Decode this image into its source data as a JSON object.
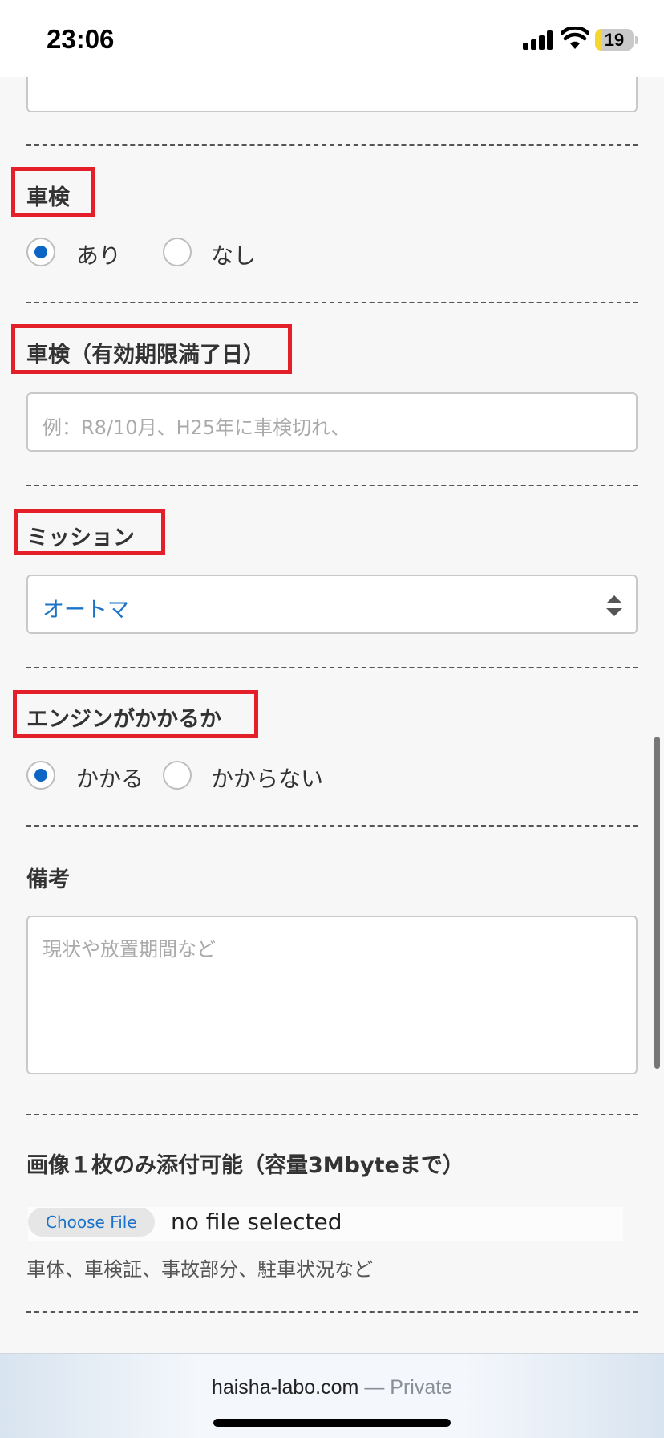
{
  "status_bar": {
    "time": "23:06",
    "battery_level": "19",
    "battery_fill": 0.19
  },
  "form": {
    "shaken": {
      "label": "車検",
      "options": [
        "あり",
        "なし"
      ],
      "selected": "あり"
    },
    "shaken_expiry": {
      "label": "車検（有効期限満了日）",
      "placeholder": "例：R8/10月、H25年に車検切れ、"
    },
    "mission": {
      "label": "ミッション",
      "value": "オートマ"
    },
    "engine": {
      "label": "エンジンがかかるか",
      "options": [
        "かかる",
        "かからない"
      ],
      "selected": "かかる"
    },
    "remarks": {
      "label": "備考",
      "placeholder": "現状や放置期間など"
    },
    "image": {
      "label": "画像１枚のみ添付可能（容量3Mbyteまで）",
      "button": "Choose File",
      "status": "no file selected",
      "hint": "車体、車検証、事故部分、駐車状況など"
    }
  },
  "browser": {
    "domain": "haisha-labo.com",
    "separator": "—",
    "mode": "Private"
  },
  "colors": {
    "highlight": "#e3202a",
    "accent": "#0a66c2",
    "select_text": "#1a73c8"
  }
}
